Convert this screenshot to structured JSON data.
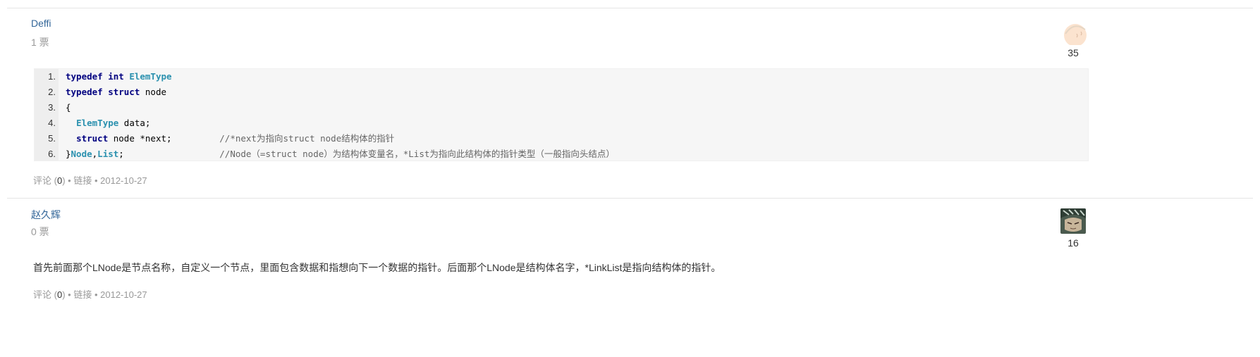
{
  "answers": [
    {
      "author": "Deffi",
      "votes": "1 票",
      "reputation": "35",
      "code_lines": [
        {
          "num": "1.",
          "parts": [
            {
              "t": "typedef int ",
              "c": "kw"
            },
            {
              "t": "ElemType",
              "c": "ty"
            }
          ]
        },
        {
          "num": "2.",
          "parts": [
            {
              "t": "typedef struct ",
              "c": "kw"
            },
            {
              "t": "node",
              "c": ""
            }
          ]
        },
        {
          "num": "3.",
          "parts": [
            {
              "t": "{",
              "c": ""
            }
          ]
        },
        {
          "num": "4.",
          "parts": [
            {
              "t": "  ",
              "c": ""
            },
            {
              "t": "ElemType",
              "c": "ty"
            },
            {
              "t": " data;",
              "c": ""
            }
          ]
        },
        {
          "num": "5.",
          "parts": [
            {
              "t": "  ",
              "c": ""
            },
            {
              "t": "struct",
              "c": "kw"
            },
            {
              "t": " node *next;         ",
              "c": ""
            },
            {
              "t": "//*next为指向struct node结构体的指针",
              "c": "cm"
            }
          ]
        },
        {
          "num": "6.",
          "parts": [
            {
              "t": "}",
              "c": ""
            },
            {
              "t": "Node",
              "c": "ty"
            },
            {
              "t": ",",
              "c": ""
            },
            {
              "t": "List",
              "c": "ty"
            },
            {
              "t": ";                  ",
              "c": ""
            },
            {
              "t": "//Node（=struct node）为结构体变量名，*List为指向此结构体的指针类型（一般指向头结点）",
              "c": "cm"
            }
          ]
        }
      ],
      "meta": {
        "comment_label": "评论",
        "comment_open": " (",
        "comment_count": "0",
        "comment_close": ")",
        "sep": " • ",
        "link_label": "链接",
        "date": "2012-10-27"
      }
    },
    {
      "author": "赵久辉",
      "votes": "0 票",
      "reputation": "16",
      "text": "首先前面那个LNode是节点名称，自定义一个节点，里面包含数据和指想向下一个数据的指针。后面那个LNode是结构体名字，*LinkList是指向结构体的指针。",
      "meta": {
        "comment_label": "评论",
        "comment_open": " (",
        "comment_count": "0",
        "comment_close": ")",
        "sep": " • ",
        "link_label": "链接",
        "date": "2012-10-27"
      }
    }
  ]
}
